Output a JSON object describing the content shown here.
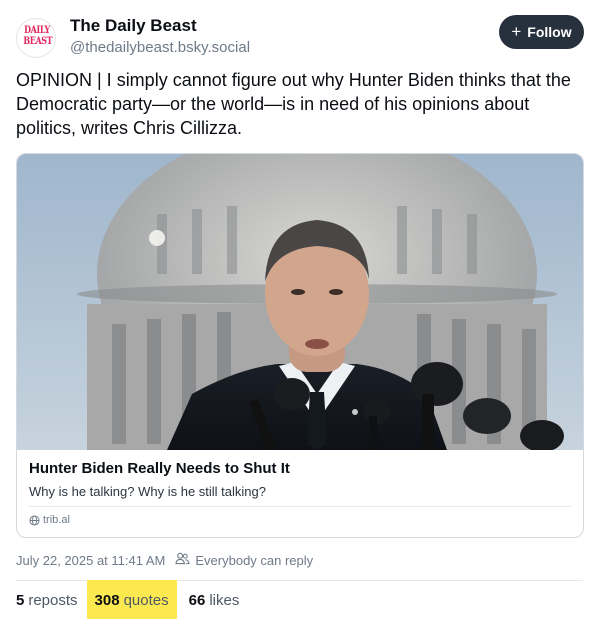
{
  "author": {
    "name": "The Daily Beast",
    "handle": "@thedailybeast.bsky.social",
    "avatar_logo_line1": "DAILY",
    "avatar_logo_line2": "BEAST"
  },
  "follow_button": {
    "icon": "plus-icon",
    "label": "Follow"
  },
  "post": {
    "text": "OPINION | I simply cannot figure out why Hunter Biden thinks that the Democratic party—or the world—is in need of his opinions about politics, writes Chris Cillizza."
  },
  "link_card": {
    "image_desc_icon": "photo-capitol-speaker",
    "title": "Hunter Biden Really Needs to Shut It",
    "description": "Why is he talking? Why is he still talking?",
    "domain_icon": "globe-icon",
    "domain": "trib.al"
  },
  "meta": {
    "timestamp": "July 22, 2025 at 11:41 AM",
    "reply_icon": "people-icon",
    "reply_setting": "Everybody can reply"
  },
  "stats": {
    "reposts": {
      "count": "5",
      "label": "reposts"
    },
    "quotes": {
      "count": "308",
      "label": "quotes"
    },
    "likes": {
      "count": "66",
      "label": "likes"
    }
  },
  "colors": {
    "follow_bg": "#27313d",
    "highlight": "#fbe94f",
    "secondary_text": "#6f7a88",
    "brand_red": "#e0245e"
  }
}
